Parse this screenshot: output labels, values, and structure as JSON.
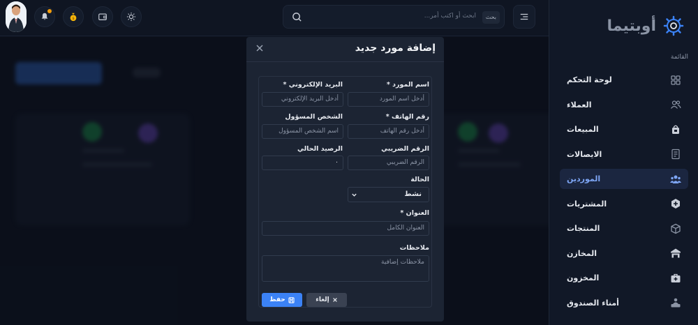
{
  "brand": {
    "name": "أوبتيما"
  },
  "sidebar": {
    "heading": "القائمة",
    "items": [
      {
        "label": "لوحة التحكم",
        "icon": "grid-icon"
      },
      {
        "label": "العملاء",
        "icon": "users-icon"
      },
      {
        "label": "المبيعات",
        "icon": "shopping-bag-icon"
      },
      {
        "label": "الايصالات",
        "icon": "receipt-icon"
      },
      {
        "label": "الموردين",
        "icon": "suppliers-icon",
        "active": true
      },
      {
        "label": "المشتريات",
        "icon": "purchase-box-icon"
      },
      {
        "label": "المنتجات",
        "icon": "cube-icon"
      },
      {
        "label": "المخازن",
        "icon": "warehouse-icon"
      },
      {
        "label": "المخزون",
        "icon": "inventory-icon"
      },
      {
        "label": "أمناء الصندوق",
        "icon": "cashier-icon"
      }
    ]
  },
  "topbar": {
    "search_placeholder": "ابحث أو اكتب أمر...",
    "search_shortcut": "بحث"
  },
  "modal": {
    "title": "إضافة مورد جديد",
    "fields": {
      "name_label": "اسم المورد *",
      "name_placeholder": "أدخل اسم المورد",
      "email_label": "البريد الإلكتروني *",
      "email_placeholder": "أدخل البريد الإلكتروني",
      "phone_label": "رقم الهاتف *",
      "phone_placeholder": "أدخل رقم الهاتف",
      "contact_label": "الشخص المسؤول",
      "contact_placeholder": "اسم الشخص المسؤول",
      "tax_label": "الرقم الضريبي",
      "tax_placeholder": "الرقم الضريبي",
      "balance_label": "الرصيد الحالي",
      "balance_value": "٠",
      "status_label": "الحالة",
      "status_value": "نشط",
      "address_label": "العنوان *",
      "address_placeholder": "العنوان الكامل",
      "notes_label": "ملاحظات",
      "notes_placeholder": "ملاحظات إضافية"
    },
    "save_label": "حفظ",
    "cancel_label": "إلغاء"
  },
  "colors": {
    "accent": "#3b82f6",
    "notification": "#f59e0b"
  }
}
